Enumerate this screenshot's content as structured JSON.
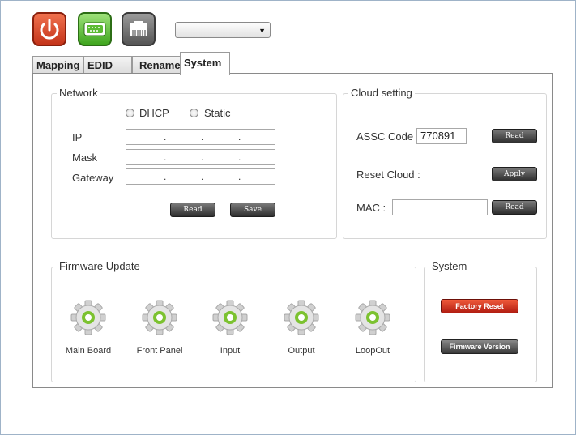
{
  "toolbar": {
    "power_icon": "power-icon",
    "serial_icon": "serial-port-icon",
    "lan_icon": "lan-port-icon",
    "device_select_value": ""
  },
  "tabs": [
    {
      "label": "Mapping",
      "active": false
    },
    {
      "label": "EDID",
      "active": false
    },
    {
      "label": "Rename",
      "active": false
    },
    {
      "label": "System",
      "active": true
    }
  ],
  "network": {
    "title": "Network",
    "dhcp_label": "DHCP",
    "static_label": "Static",
    "ip_label": "IP",
    "mask_label": "Mask",
    "gateway_label": "Gateway",
    "read_label": "Read",
    "save_label": "Save"
  },
  "cloud": {
    "title": "Cloud setting",
    "assc_label": "ASSC Code :",
    "assc_value": "770891",
    "read_label": "Read",
    "reset_label": "Reset Cloud :",
    "apply_label": "Apply",
    "mac_label": "MAC :",
    "mac_value": "",
    "mac_read_label": "Read"
  },
  "firmware": {
    "title": "Firmware Update",
    "items": [
      {
        "label": "Main Board"
      },
      {
        "label": "Front Panel"
      },
      {
        "label": "Input"
      },
      {
        "label": "Output"
      },
      {
        "label": "LoopOut"
      }
    ]
  },
  "system": {
    "title": "System",
    "factory_reset_label": "Factory Reset",
    "firmware_version_label": "Firmware Version"
  },
  "colors": {
    "power": "#d9452a",
    "serial": "#5cbb33",
    "lan": "#707070",
    "gear_center": "#7cc230",
    "factory_reset": "#cc2a18"
  }
}
